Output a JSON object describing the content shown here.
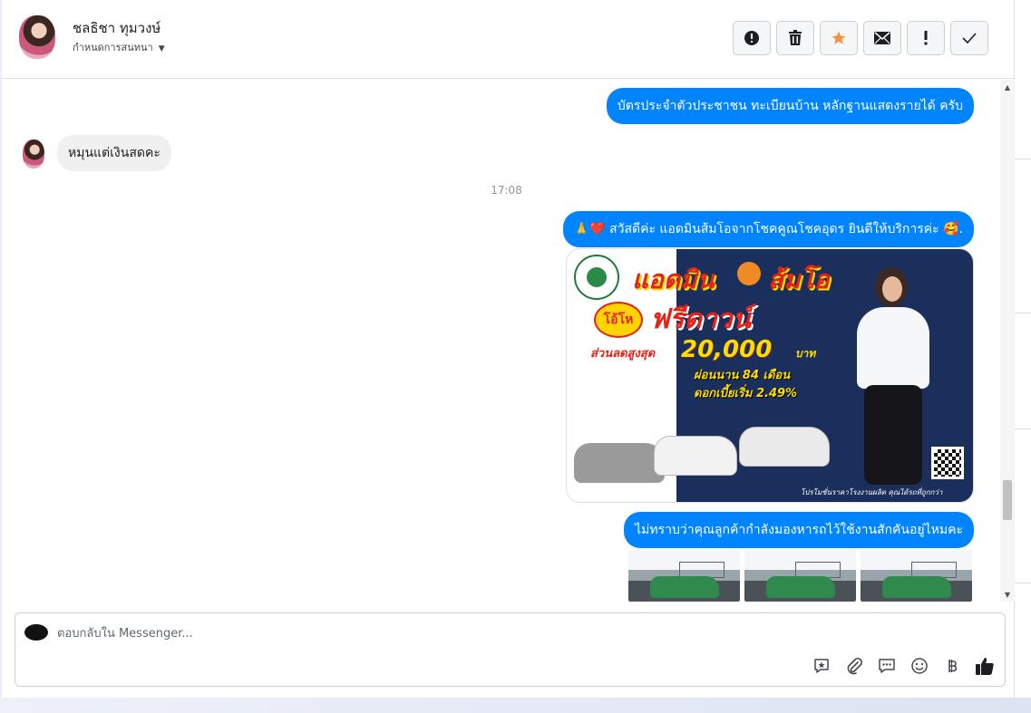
{
  "header": {
    "contact_name": "ชลธิชา ทุมวงษ์",
    "subtitle": "กำหนดการสนทนา",
    "toolbar": [
      {
        "name": "spam-button",
        "icon": "alert-circle-icon"
      },
      {
        "name": "delete-button",
        "icon": "trash-icon"
      },
      {
        "name": "star-button",
        "icon": "star-icon"
      },
      {
        "name": "mark-unread-button",
        "icon": "envelope-icon"
      },
      {
        "name": "important-button",
        "icon": "exclamation-icon"
      },
      {
        "name": "done-button",
        "icon": "check-icon"
      }
    ],
    "star_color": "#f7923a"
  },
  "messages": {
    "msg1": "บัตรประจำตัวประชาชน ทะเบียนบ้าน หลักฐานแสดงรายได้ ครับ",
    "msg2": "หมุนแต่เงินสดคะ",
    "timestamp": "17:08",
    "msg3_text": "สวัสดีค่ะ แอดมินส้มโอจากโชคคูณโชคอุดร ยินดีให้บริการค่ะ",
    "msg3_prefix": "🙏❤️",
    "msg3_suffix": "🥰.",
    "msg4": "ไม่ทราบว่าคุณลูกค้ากำลังมองหารถไว้ใช้งานสักคันอยู่ไหมคะ"
  },
  "promo": {
    "title_a": "แอดมิน",
    "title_b": "ส้มโอ",
    "burst": "โอ้โห",
    "title2": "ฟรีดาวน์",
    "discount_label": "ส่วนลดสูงสุด",
    "amount": "20,000",
    "unit": "บาท",
    "installments": "ผ่อนนาน 84 เดือน",
    "interest": "ดอกเบี้ยเริ่ม 2.49%",
    "tagline": "โปรโมชั่นราคาโรงงานผลิต คุณได้รถที่ถูกกว่า"
  },
  "composer": {
    "placeholder": "ตอบกลับใน Messenger..."
  },
  "colors": {
    "outgoing_bubble": "#0084ff",
    "incoming_bubble": "#f0f0f0"
  }
}
